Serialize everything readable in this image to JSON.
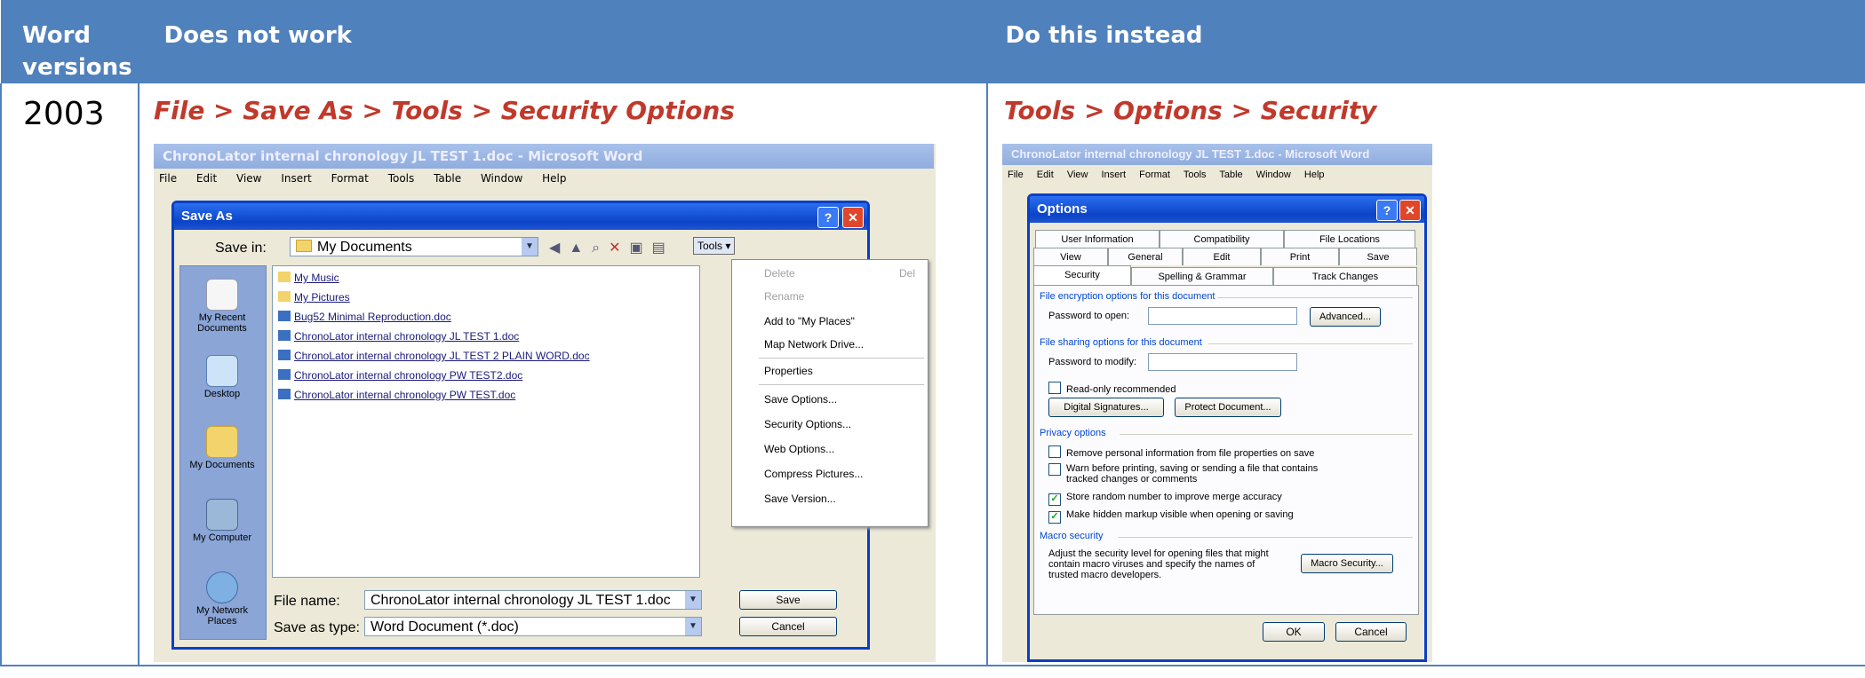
{
  "table": {
    "headers": {
      "versions": "Word versions",
      "not_work": "Does not work",
      "instead": "Do  this instead"
    },
    "rows": [
      {
        "version": "2003",
        "not_work_path": "File > Save As > Tools > Security Options",
        "instead_path": "Tools > Options > Security"
      }
    ]
  },
  "left_shot": {
    "word_title": "ChronoLator internal chronology JL TEST 1.doc - Microsoft Word",
    "menu": [
      "File",
      "Edit",
      "View",
      "Insert",
      "Format",
      "Tools",
      "Table",
      "Window",
      "Help"
    ],
    "dialog_title": "Save As",
    "save_in_label": "Save in:",
    "save_in_value": "My Documents",
    "tools_label": "Tools ▾",
    "places": [
      "My Recent Documents",
      "Desktop",
      "My Documents",
      "My Computer",
      "My Network Places"
    ],
    "files": [
      "My Music",
      "My Pictures",
      "Bug52 Minimal Reproduction.doc",
      "ChronoLator internal chronology JL TEST 1.doc",
      "ChronoLator internal chronology JL TEST 2 PLAIN WORD.doc",
      "ChronoLator internal chronology PW TEST2.doc",
      "ChronoLator internal chronology PW TEST.doc"
    ],
    "tools_menu": {
      "delete": "Delete",
      "delete_key": "Del",
      "rename": "Rename",
      "add_places": "Add to \"My Places\"",
      "map_drive": "Map Network Drive...",
      "properties": "Properties",
      "save_options": "Save Options...",
      "security_options": "Security Options...",
      "web_options": "Web Options...",
      "compress": "Compress Pictures...",
      "save_version": "Save Version..."
    },
    "file_name_label": "File name:",
    "file_name_value": "ChronoLator internal chronology JL TEST 1.doc",
    "save_type_label": "Save as type:",
    "save_type_value": "Word Document (*.doc)",
    "save_button": "Save",
    "cancel_button": "Cancel"
  },
  "right_shot": {
    "word_title": "ChronoLator internal chronology JL TEST 1.doc - Microsoft Word",
    "menu": [
      "File",
      "Edit",
      "View",
      "Insert",
      "Format",
      "Tools",
      "Table",
      "Window",
      "Help"
    ],
    "dialog_title": "Options",
    "tabs_row1": [
      "User Information",
      "Compatibility",
      "File Locations"
    ],
    "tabs_row2": [
      "View",
      "General",
      "Edit",
      "Print",
      "Save"
    ],
    "tabs_row3": [
      "Security",
      "Spelling & Grammar",
      "Track Changes"
    ],
    "encryption_group": "File encryption options for this document",
    "password_open": "Password to open:",
    "advanced_button": "Advanced...",
    "sharing_group": "File sharing options for this document",
    "password_modify": "Password to modify:",
    "read_only": "Read-only recommended",
    "digital_sig_button": "Digital Signatures...",
    "protect_button": "Protect Document...",
    "privacy_group": "Privacy options",
    "privacy_items": [
      {
        "label": "Remove personal information from file properties on save",
        "checked": false
      },
      {
        "label": "Warn before printing, saving or sending a file that contains tracked changes or comments",
        "checked": false
      },
      {
        "label": "Store random number to improve merge accuracy",
        "checked": true
      },
      {
        "label": "Make hidden markup visible when opening or saving",
        "checked": true
      }
    ],
    "macro_group": "Macro security",
    "macro_text": "Adjust the security level for opening files that might contain macro viruses and specify the names of trusted macro developers.",
    "macro_button": "Macro Security...",
    "ok_button": "OK",
    "cancel_button": "Cancel"
  }
}
